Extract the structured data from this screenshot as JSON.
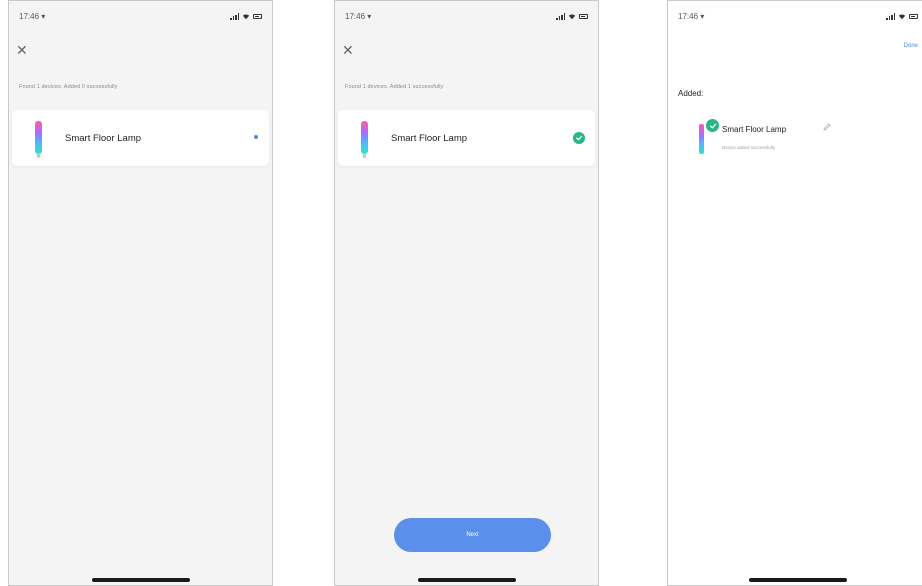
{
  "screens": [
    {
      "status": {
        "time": "17:46 ▾"
      },
      "found_text": "Found 1 devices. Added 0 successfully",
      "device": {
        "name": "Smart Floor Lamp"
      }
    },
    {
      "status": {
        "time": "17:46 ▾"
      },
      "found_text": "Found 1 devices. Added 1 successfully",
      "device": {
        "name": "Smart Floor Lamp"
      },
      "next_label": "Next"
    },
    {
      "status": {
        "time": "17:46 ▾"
      },
      "done_label": "Done",
      "added_title": "Added:",
      "device": {
        "name": "Smart Floor Lamp",
        "subtext": "Device added successfully"
      }
    }
  ],
  "colors": {
    "accent": "#4a89e8",
    "success": "#29b585",
    "button": "#5a8fec"
  }
}
